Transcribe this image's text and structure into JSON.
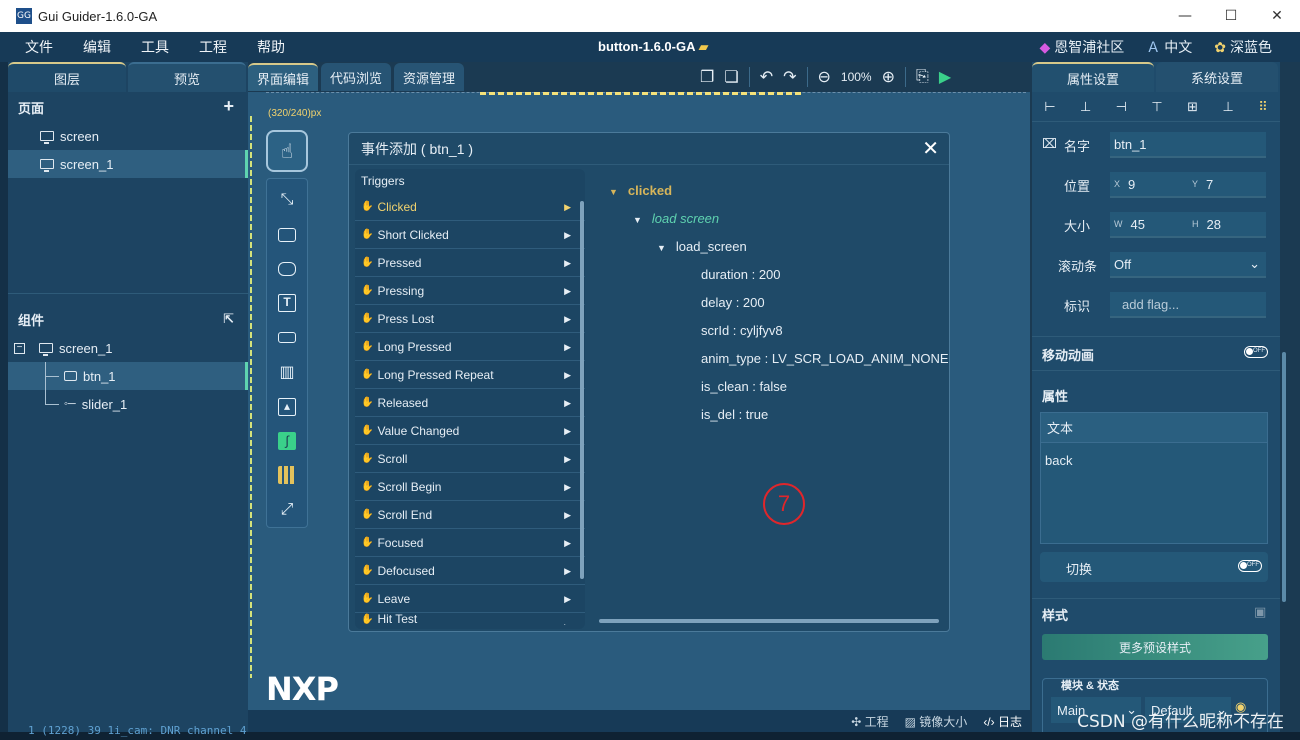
{
  "window": {
    "title": "Gui Guider-1.6.0-GA",
    "logo_text": "GG"
  },
  "menu": {
    "items": [
      "文件",
      "编辑",
      "工具",
      "工程",
      "帮助"
    ],
    "project_title": "button-1.6.0-GA",
    "community": "恩智浦社区",
    "language": "中文",
    "theme": "深蓝色"
  },
  "left_panel": {
    "tabs": [
      "图层",
      "预览"
    ],
    "pages_title": "页面",
    "pages": [
      "screen",
      "screen_1"
    ],
    "components_title": "组件",
    "tree": {
      "root": "screen_1",
      "children": [
        "btn_1",
        "slider_1"
      ]
    }
  },
  "center": {
    "tabs": [
      "界面编辑",
      "代码浏览",
      "资源管理"
    ],
    "zoom": "100%",
    "canvas_size": "(320/240)px",
    "logo": "NXP"
  },
  "dialog": {
    "title": "事件添加 ( btn_1 )",
    "triggers_label": "Triggers",
    "triggers": [
      "Clicked",
      "Short Clicked",
      "Pressed",
      "Pressing",
      "Press Lost",
      "Long Pressed",
      "Long Pressed Repeat",
      "Released",
      "Value Changed",
      "Scroll",
      "Scroll Begin",
      "Scroll End",
      "Focused",
      "Defocused",
      "Leave",
      "Hit Test"
    ],
    "event": "clicked",
    "action": "load screen",
    "action_detail": "load_screen",
    "params": [
      "duration : 200",
      "delay : 200",
      "scrId : cyljfyv8",
      "anim_type : LV_SCR_LOAD_ANIM_NONE",
      "is_clean : false",
      "is_del : true"
    ],
    "annotation": "7"
  },
  "statusbar": {
    "project": "工程",
    "mirror": "镜像大小",
    "log": "日志"
  },
  "right_panel": {
    "tabs": [
      "属性设置",
      "系统设置"
    ],
    "name_label": "名字",
    "name_value": "btn_1",
    "pos_label": "位置",
    "pos_x": "9",
    "pos_y": "7",
    "size_label": "大小",
    "size_w": "45",
    "size_h": "28",
    "scroll_label": "滚动条",
    "scroll_value": "Off",
    "flag_label": "标识",
    "flag_placeholder": "add flag...",
    "anim_label": "移动动画",
    "props_label": "属性",
    "text_label": "文本",
    "text_value": "back",
    "switch_label": "切换",
    "style_label": "样式",
    "preset_button": "更多预设样式",
    "state_label": "模块 & 状态",
    "module_value": "Main",
    "state_value": "Default",
    "toggle_off": "OFF",
    "x_tag": "X",
    "y_tag": "Y",
    "w_tag": "W",
    "h_tag": "H"
  },
  "terminal_text": "1 (1228) 39 1i_cam: DNR channel 4",
  "watermark": "CSDN @有什么昵称不存在"
}
